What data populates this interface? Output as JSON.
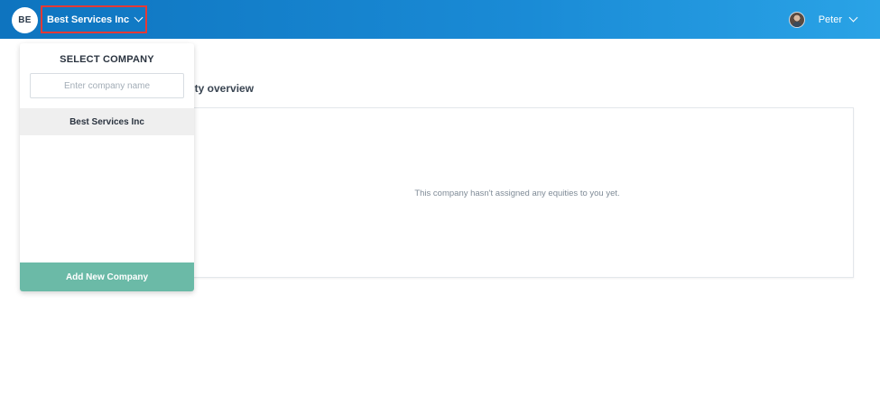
{
  "header": {
    "company_initials": "BE",
    "company_name": "Best Services Inc",
    "user_name": "Peter"
  },
  "main": {
    "section_title": "uity overview",
    "empty_message": "This company hasn't assigned any equities to you yet."
  },
  "dropdown": {
    "title": "SELECT COMPANY",
    "search_placeholder": "Enter company name",
    "companies": [
      "Best Services Inc"
    ],
    "add_button_label": "Add New Company"
  },
  "colors": {
    "header_gradient_start": "#0e74bf",
    "header_gradient_end": "#2aa3e6",
    "highlight_border": "#e53935",
    "add_button": "#6bbaa7"
  }
}
